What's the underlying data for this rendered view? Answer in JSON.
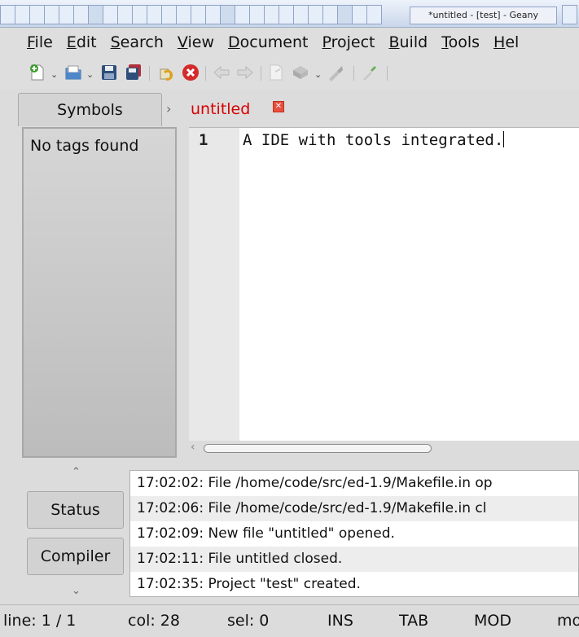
{
  "window": {
    "title": "*untitled - [test] - Geany"
  },
  "menubar": {
    "items": [
      {
        "label": "File",
        "mnemonic": "F",
        "rest": "ile"
      },
      {
        "label": "Edit",
        "mnemonic": "E",
        "rest": "dit"
      },
      {
        "label": "Search",
        "mnemonic": "S",
        "rest": "earch"
      },
      {
        "label": "View",
        "mnemonic": "V",
        "rest": "iew"
      },
      {
        "label": "Document",
        "mnemonic": "D",
        "rest": "ocument"
      },
      {
        "label": "Project",
        "mnemonic": "P",
        "rest": "roject"
      },
      {
        "label": "Build",
        "mnemonic": "B",
        "rest": "uild"
      },
      {
        "label": "Tools",
        "mnemonic": "T",
        "rest": "ools"
      },
      {
        "label": "Help",
        "mnemonic": "H",
        "rest": "el"
      }
    ]
  },
  "toolbar": {
    "icons": [
      "new-file-icon",
      "open-file-icon",
      "save-icon",
      "save-all-icon",
      "revert-icon",
      "close-icon",
      "back-icon",
      "forward-icon",
      "compile-icon",
      "build-icon",
      "run-icon",
      "color-picker-icon"
    ]
  },
  "sidebar": {
    "tab_label": "Symbols",
    "empty_text": "No tags found"
  },
  "editor": {
    "tab_label": "untitled",
    "line_number": "1",
    "code": "A IDE with tools integrated."
  },
  "messages": {
    "tabs": [
      "Status",
      "Compiler"
    ],
    "rows": [
      "17:02:02: File /home/code/src/ed-1.9/Makefile.in op",
      "17:02:06: File /home/code/src/ed-1.9/Makefile.in cl",
      "17:02:09: New file \"untitled\" opened.",
      "17:02:11: File untitled closed.",
      "17:02:35: Project \"test\" created."
    ]
  },
  "statusbar": {
    "line": "line: 1 / 1",
    "col": "col: 28",
    "sel": "sel: 0",
    "ins": "INS",
    "tab": "TAB",
    "mod": "MOD",
    "mode": "mo"
  },
  "colors": {
    "accent_tab": "#d60000",
    "close_badge": "#e8503d"
  }
}
